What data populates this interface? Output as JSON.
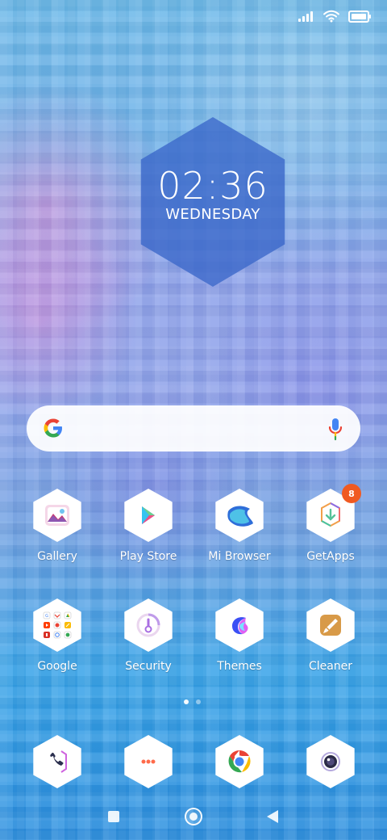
{
  "clock": {
    "time": "02:36",
    "day": "WEDNESDAY"
  },
  "apps": [
    {
      "label": "Gallery",
      "icon": "gallery-icon"
    },
    {
      "label": "Play Store",
      "icon": "play-store-icon"
    },
    {
      "label": "Mi Browser",
      "icon": "mi-browser-icon"
    },
    {
      "label": "GetApps",
      "icon": "getapps-icon",
      "badge": "8"
    },
    {
      "label": "Google",
      "icon": "google-folder-icon"
    },
    {
      "label": "Security",
      "icon": "security-icon"
    },
    {
      "label": "Themes",
      "icon": "themes-icon"
    },
    {
      "label": "Cleaner",
      "icon": "cleaner-icon"
    }
  ],
  "dock": [
    {
      "icon": "phone-icon"
    },
    {
      "icon": "messages-icon"
    },
    {
      "icon": "chrome-icon"
    },
    {
      "icon": "camera-icon"
    }
  ],
  "colors": {
    "badge": "#f05a22",
    "widget": "#3a67c9"
  }
}
